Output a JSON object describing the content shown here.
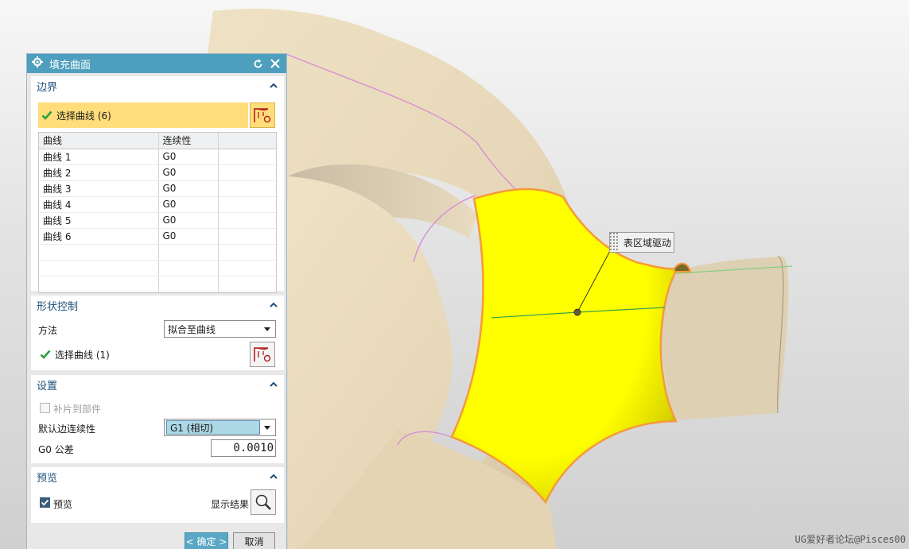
{
  "viewport": {
    "annotation": "表区域驱动",
    "watermark": "UG爱好者论坛@Pisces00"
  },
  "dialog": {
    "title": "填充曲面",
    "boundary": {
      "header": "边界",
      "select_label": "选择曲线 (6)",
      "table": {
        "columns": [
          "曲线",
          "连续性",
          ""
        ],
        "rows": [
          [
            "曲线 1",
            "G0",
            ""
          ],
          [
            "曲线 2",
            "G0",
            ""
          ],
          [
            "曲线 3",
            "G0",
            ""
          ],
          [
            "曲线 4",
            "G0",
            ""
          ],
          [
            "曲线 5",
            "G0",
            ""
          ],
          [
            "曲线 6",
            "G0",
            ""
          ],
          [
            "",
            "",
            ""
          ],
          [
            "",
            "",
            ""
          ],
          [
            "",
            "",
            ""
          ]
        ]
      }
    },
    "shape_control": {
      "header": "形状控制",
      "method_label": "方法",
      "method_value": "拟合至曲线",
      "select_label": "选择曲线 (1)"
    },
    "settings": {
      "header": "设置",
      "patch_label": "补片到部件",
      "patch_checked": false,
      "default_continuity_label": "默认边连续性",
      "default_continuity_value": "G1 (相切)",
      "g0_tolerance_label": "G0 公差",
      "g0_tolerance_value": "0.0010"
    },
    "preview": {
      "header": "预览",
      "preview_label": "预览",
      "preview_checked": true,
      "show_result_label": "显示结果"
    },
    "buttons": {
      "ok": "< 确定 >",
      "cancel": "取消"
    }
  },
  "colors": {
    "titlebar": "#4d9fbd",
    "section_header_text": "#1f4f7a",
    "selection_yellow": "#fedd7a",
    "surface_fill": "#ffff00",
    "surface_edge": "#f59a3a",
    "tube_body": "#e6d7b8",
    "boundary_curve": "#d58ad6",
    "centerline": "#6cc76c"
  },
  "icons": [
    "settings-gear-icon",
    "reset-icon",
    "close-icon",
    "collapse-chevron-icon",
    "check-icon",
    "curve-select-icon",
    "magnifier-icon"
  ]
}
